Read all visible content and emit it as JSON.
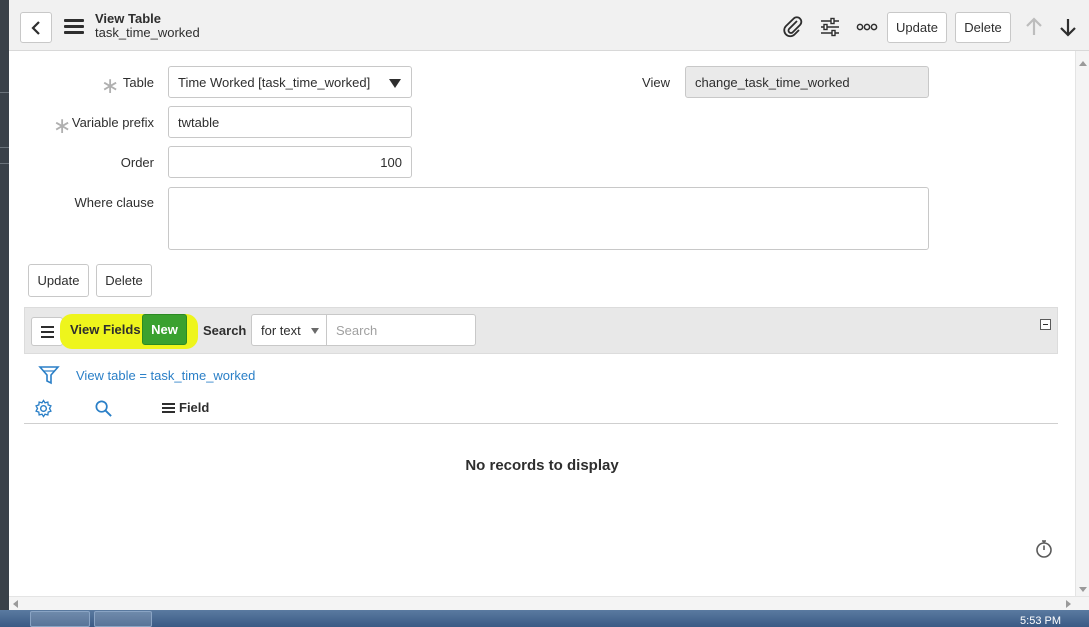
{
  "header": {
    "title": "View Table",
    "subtitle": "task_time_worked",
    "update_label": "Update",
    "delete_label": "Delete"
  },
  "form": {
    "table_label": "Table",
    "table_value": "Time Worked [task_time_worked]",
    "view_label": "View",
    "view_value": "change_task_time_worked",
    "variable_prefix_label": "Variable prefix",
    "variable_prefix_value": "twtable",
    "order_label": "Order",
    "order_value": "100",
    "where_clause_label": "Where clause",
    "where_clause_value": "",
    "update_label": "Update",
    "delete_label": "Delete"
  },
  "related_list": {
    "title": "View Fields",
    "new_label": "New",
    "search_label": "Search",
    "search_scope": "for text",
    "search_placeholder": "Search",
    "filter_text": "View table = task_time_worked",
    "column_field": "Field",
    "empty_message": "No records to display"
  },
  "taskbar": {
    "clock": "5:53 PM"
  },
  "colors": {
    "highlight": "#eef51c",
    "new_button": "#3aa12f",
    "link": "#2a7fc7"
  }
}
